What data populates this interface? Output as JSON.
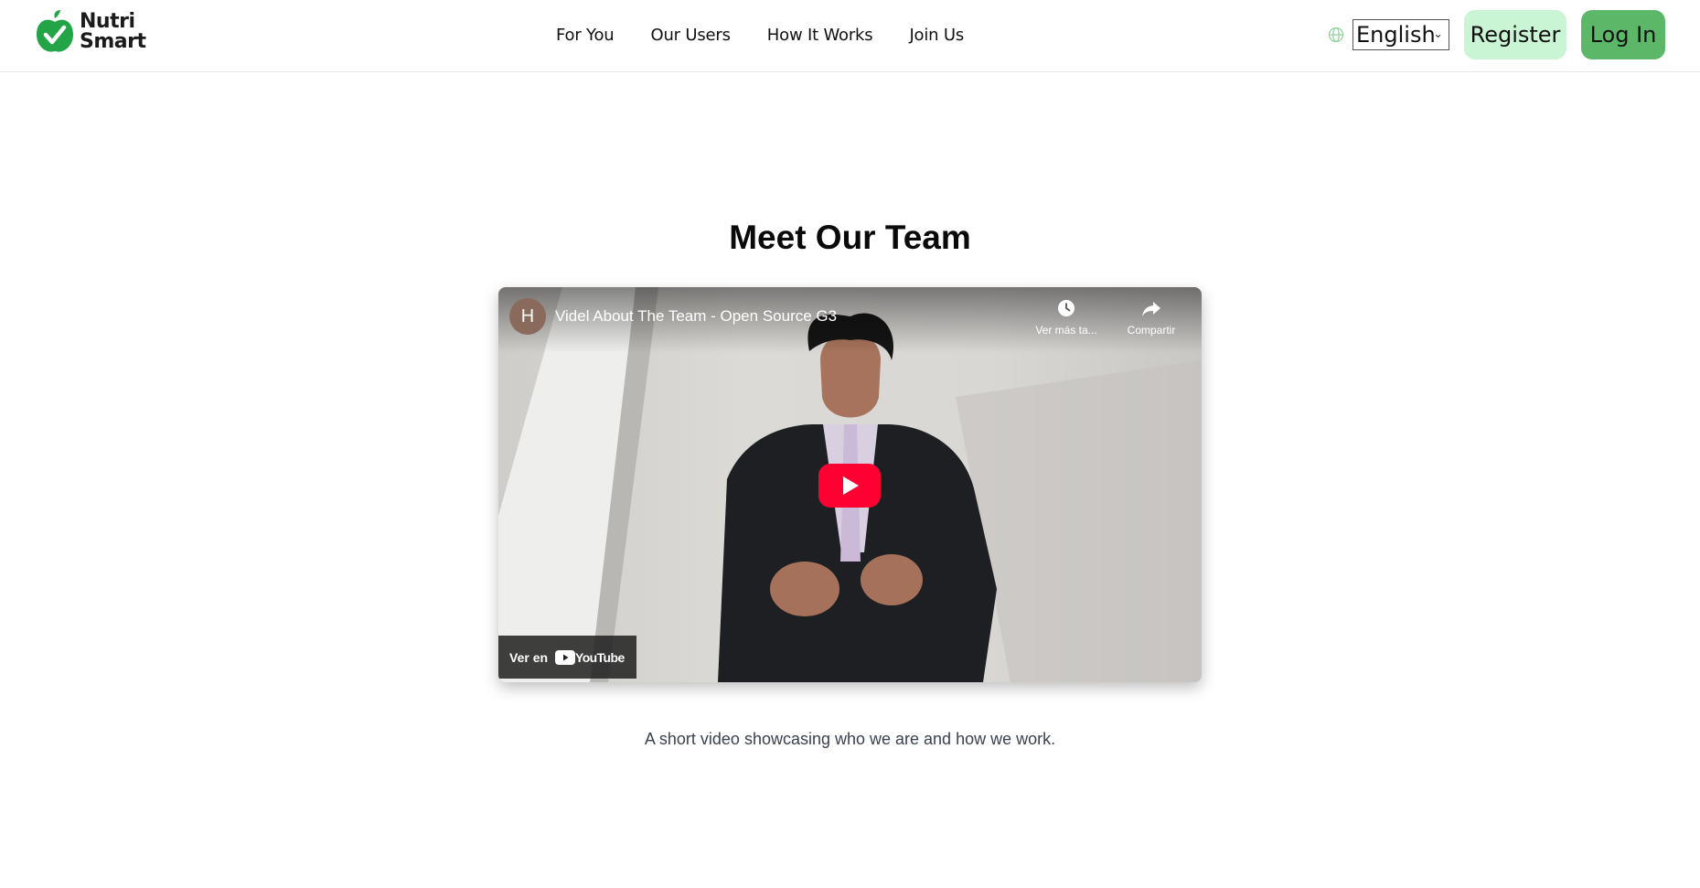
{
  "header": {
    "logo_line1": "Nutri",
    "logo_line2": "Smart",
    "nav": [
      {
        "label": "For You"
      },
      {
        "label": "Our Users"
      },
      {
        "label": "How It Works"
      },
      {
        "label": "Join Us"
      }
    ],
    "language": "English",
    "register_label": "Register",
    "login_label": "Log In",
    "icons": {
      "logo": "apple-check-icon",
      "language": "globe-icon"
    },
    "colors": {
      "brand_green": "#22a447",
      "register_bg": "#c9f5d5",
      "login_bg": "#5cb868"
    }
  },
  "main": {
    "title": "Meet Our Team",
    "video": {
      "channel_initial": "H",
      "title": "Videl About The Team - Open Source G3",
      "watch_later_label": "Ver más ta...",
      "share_label": "Compartir",
      "watch_on_label": "Ver en",
      "youtube_label": "YouTube",
      "icons": [
        "clock-icon",
        "share-icon",
        "play-icon",
        "youtube-logo-icon"
      ]
    },
    "caption": "A short video showcasing who we are and how we work."
  }
}
